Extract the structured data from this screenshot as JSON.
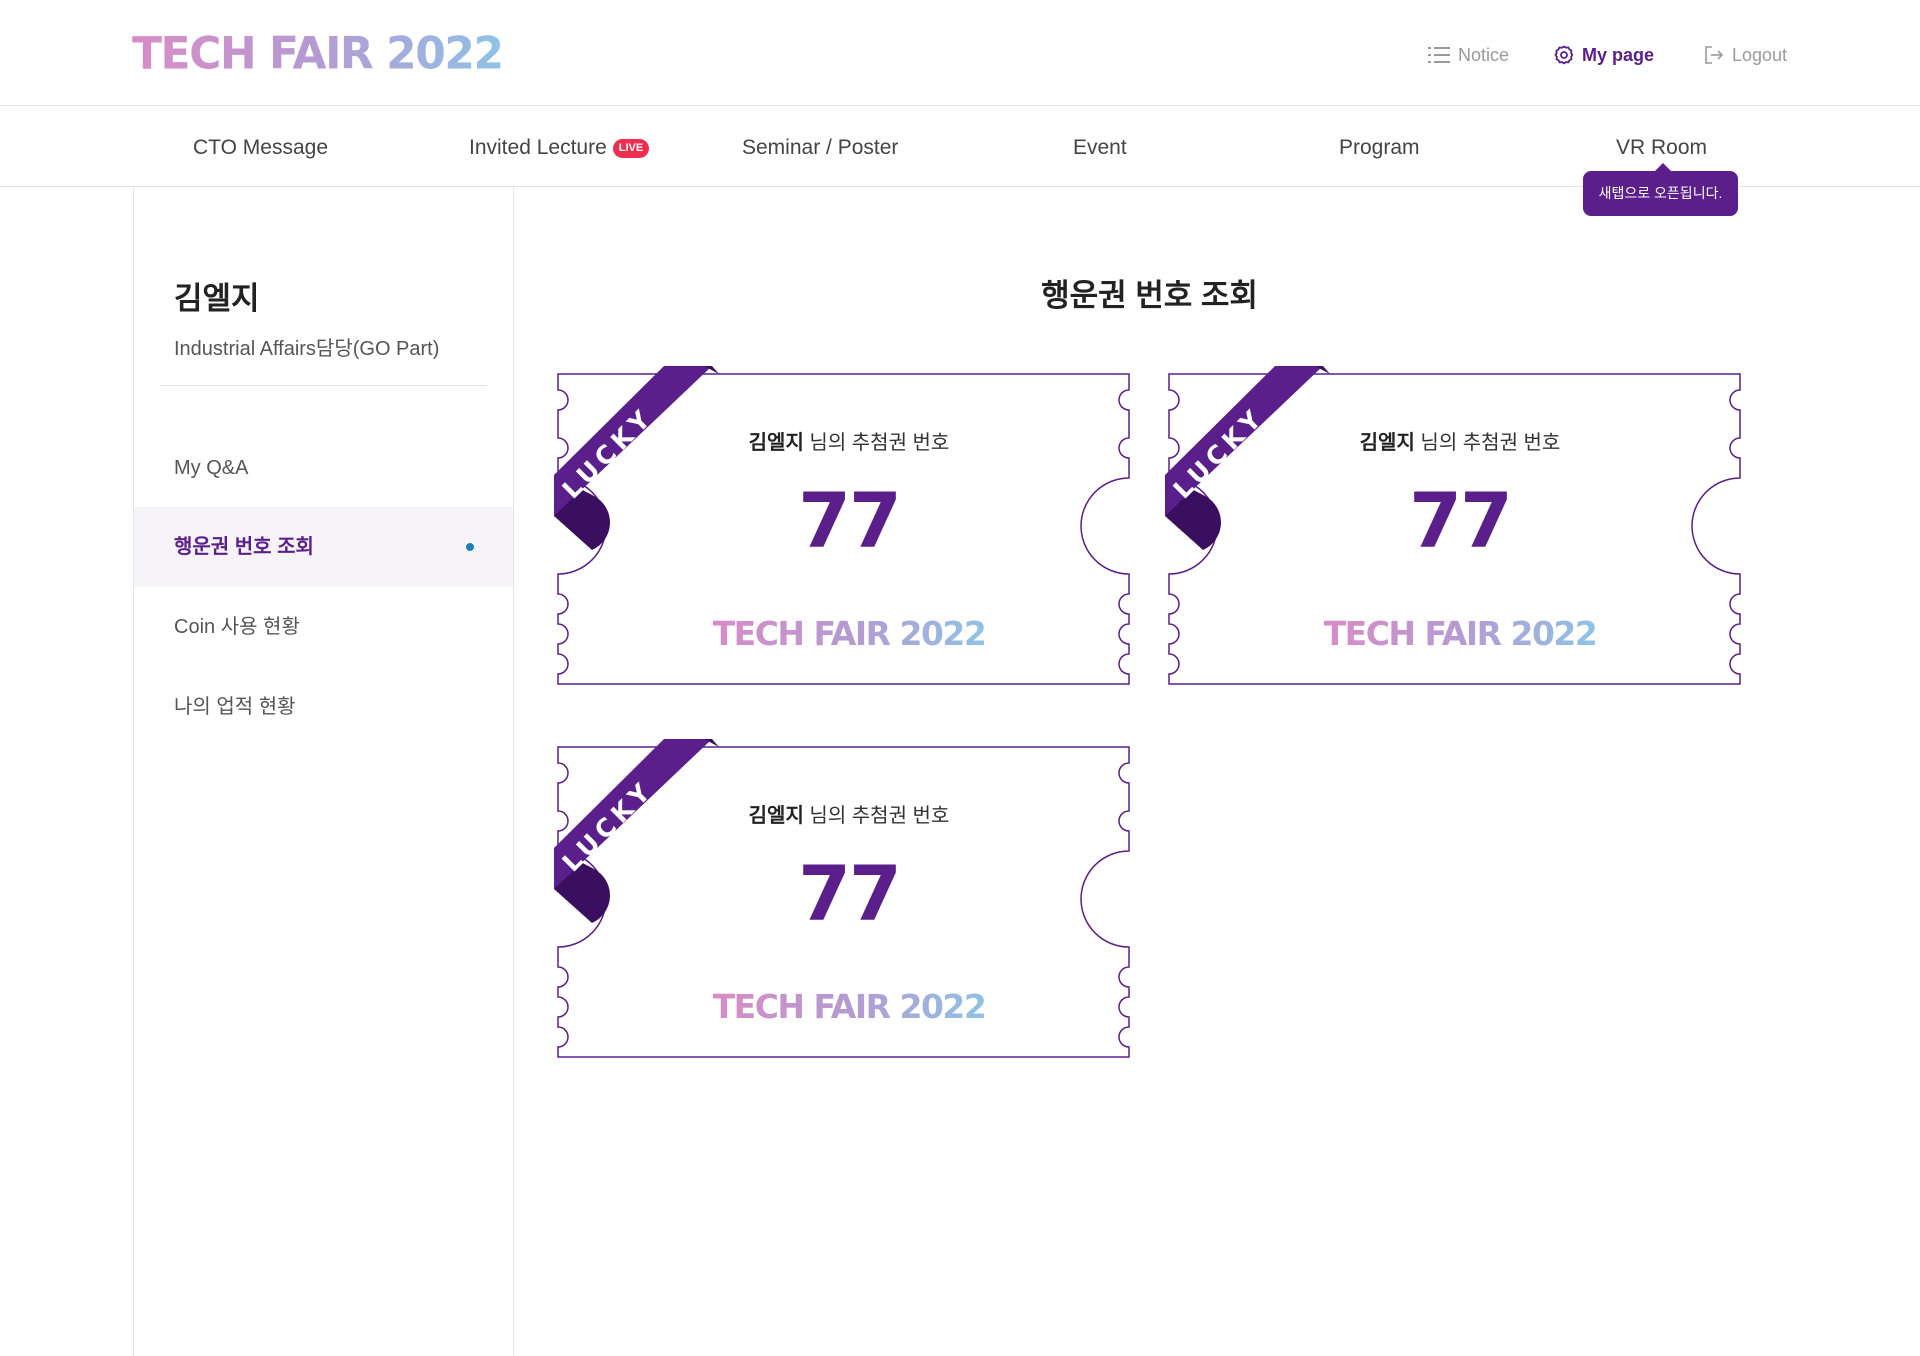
{
  "header": {
    "logo": "TECH FAIR 2022",
    "notice_label": "Notice",
    "mypage_label": "My page",
    "logout_label": "Logout"
  },
  "gnb": {
    "items": [
      {
        "label": "CTO Message"
      },
      {
        "label": "Invited Lecture",
        "badge": "LIVE"
      },
      {
        "label": "Seminar / Poster"
      },
      {
        "label": "Event"
      },
      {
        "label": "Program"
      },
      {
        "label": "VR Room"
      }
    ],
    "tooltip": "새탭으로 오픈됩니다."
  },
  "sidebar": {
    "user_name": "김엘지",
    "user_dept": "Industrial Affairs담당(GO Part)",
    "items": [
      {
        "label": "My Q&A"
      },
      {
        "label": "행운권 번호 조회",
        "active": true
      },
      {
        "label": "Coin 사용 현황"
      },
      {
        "label": "나의 업적 현황"
      }
    ]
  },
  "main": {
    "title": "행운권 번호 조회",
    "tickets": [
      {
        "ribbon": "LUCKY",
        "name": "김엘지",
        "suffix": " 님의 추첨권 번호",
        "number": "77",
        "logo": "TECH FAIR 2022"
      },
      {
        "ribbon": "LUCKY",
        "name": "김엘지",
        "suffix": " 님의 추첨권 번호",
        "number": "77",
        "logo": "TECH FAIR 2022"
      },
      {
        "ribbon": "LUCKY",
        "name": "김엘지",
        "suffix": " 님의 추첨권 번호",
        "number": "77",
        "logo": "TECH FAIR 2022"
      }
    ]
  },
  "colors": {
    "brand_purple": "#5a1f8a",
    "ribbon_dark": "#3a0f60",
    "live_red": "#ee2d4f",
    "active_dot": "#1a82b8",
    "logo_gradient": [
      "#d98cc6",
      "#b59ad2",
      "#8fc3e6"
    ]
  }
}
